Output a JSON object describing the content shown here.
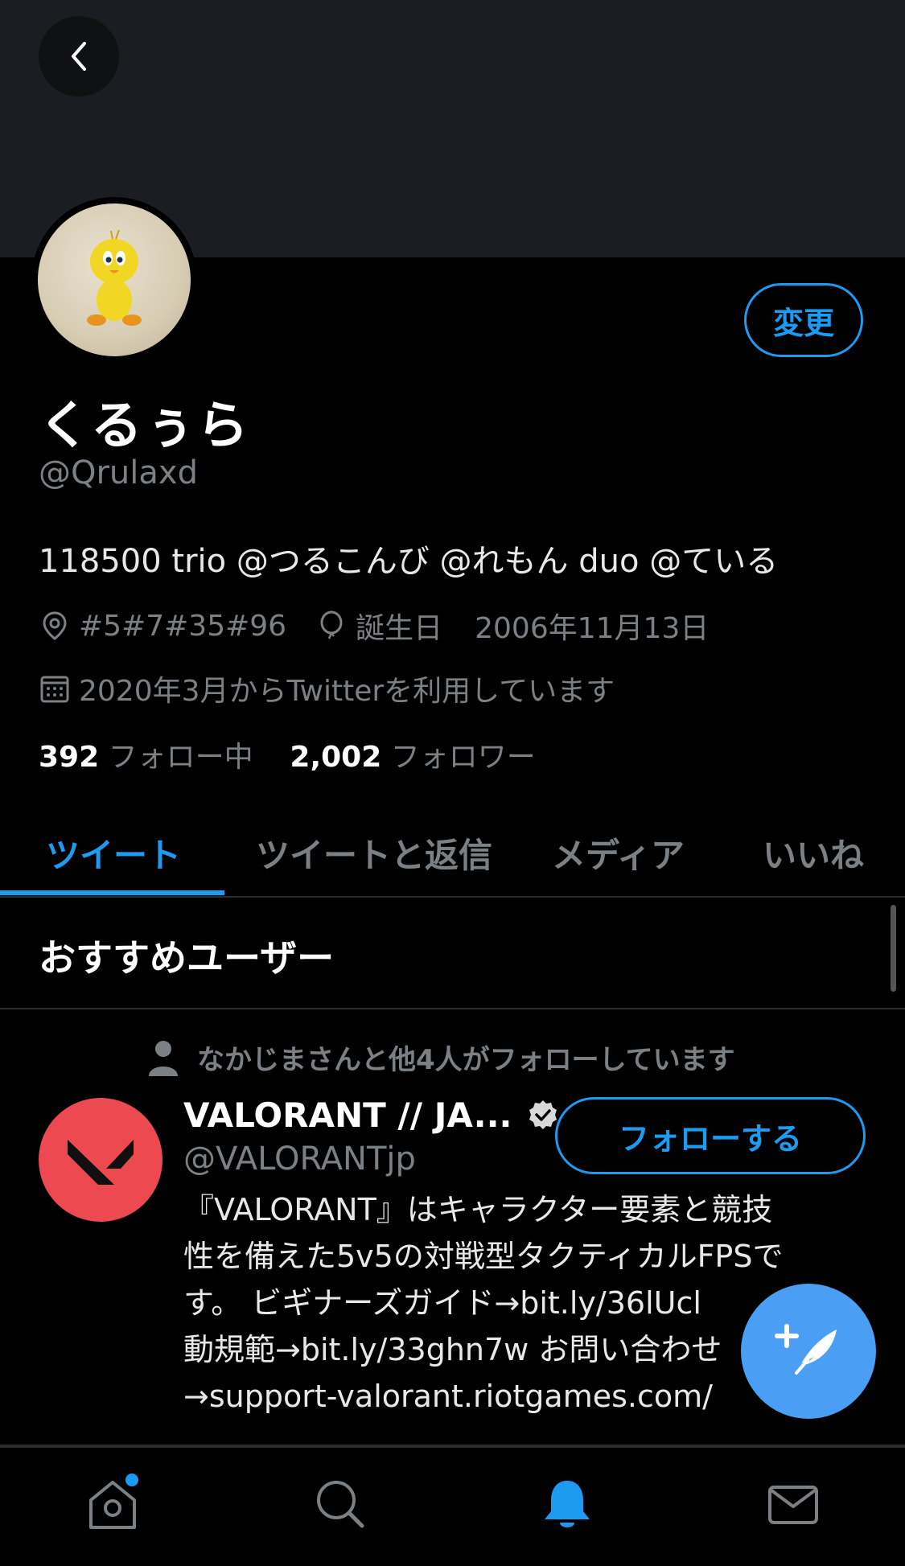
{
  "header": {
    "back_icon": "chevron-left-icon"
  },
  "profile": {
    "edit_label": "変更",
    "display_name": "くるぅら",
    "handle": "@Qrulaxd",
    "bio": "118500 trio @つるこんび @れもん duo @ている",
    "location": "#5#7#35#96",
    "birthday_label": "誕生日",
    "birthday": "2006年11月13日",
    "joined": "2020年3月からTwitterを利用しています",
    "following_count": "392",
    "following_label": "フォロー中",
    "followers_count": "2,002",
    "followers_label": "フォロワー"
  },
  "tabs": [
    {
      "label": "ツイート",
      "active": true
    },
    {
      "label": "ツイートと返信",
      "active": false
    },
    {
      "label": "メディア",
      "active": false
    },
    {
      "label": "いいね",
      "active": false
    }
  ],
  "recommendations": {
    "title": "おすすめユーザー",
    "social_context": "なかじまさんと他4人がフォローしています",
    "user": {
      "name": "VALORANT // JA...",
      "handle": "@VALORANTjp",
      "follow_label": "フォローする",
      "bio_lines": [
        "『VALORANT』はキャラクター要素と競技",
        "性を備えた5v5の対戦型タクティカルFPSで",
        "す。 ビギナーズガイド→bit.ly/36lUcl",
        "動規範→bit.ly/33ghn7w お問い合わせ",
        "→support-valorant.riotgames.com/"
      ]
    }
  },
  "bottom_nav": [
    {
      "name": "home-icon",
      "active": false,
      "has_badge": true
    },
    {
      "name": "search-icon",
      "active": false
    },
    {
      "name": "bell-icon",
      "active": true
    },
    {
      "name": "mail-icon",
      "active": false
    }
  ],
  "colors": {
    "accent": "#1d9bf0",
    "muted": "#7b8085",
    "valorant": "#ec4a50"
  }
}
